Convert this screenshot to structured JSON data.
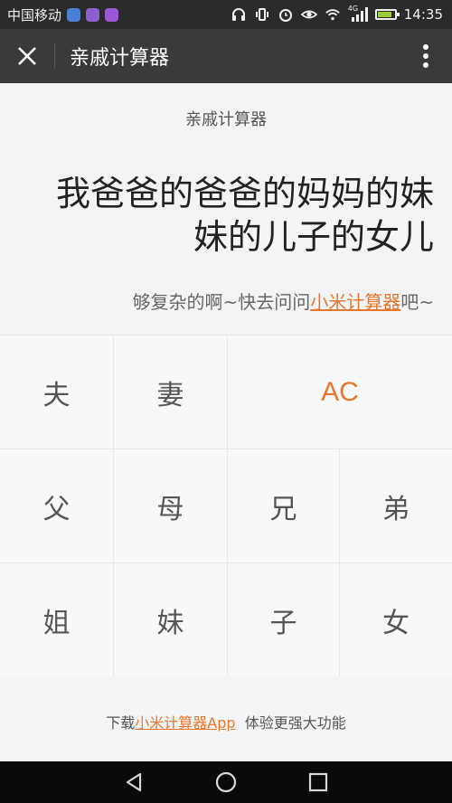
{
  "status_bar": {
    "carrier": "中国移动",
    "network": "4G",
    "time": "14:35",
    "battery_level": 0.85
  },
  "title_bar": {
    "title": "亲戚计算器"
  },
  "display": {
    "calculator_name": "亲戚计算器",
    "expression": "我爸爸的爸爸的妈妈的妹妹的儿子的女儿",
    "hint_prefix": "够复杂的啊~快去问问",
    "hint_link": "小米计算器",
    "hint_suffix": "吧~"
  },
  "keypad": {
    "keys": [
      "夫",
      "妻",
      "AC",
      "父",
      "母",
      "兄",
      "弟",
      "姐",
      "妹",
      "子",
      "女"
    ]
  },
  "footer": {
    "prefix": "下载",
    "link": "小米计算器App",
    "suffix": "  体验更强大功能"
  },
  "colors": {
    "accent": "#e8762c",
    "title_bar": "#3a3a3a",
    "status_bar": "#2b2b2b"
  }
}
